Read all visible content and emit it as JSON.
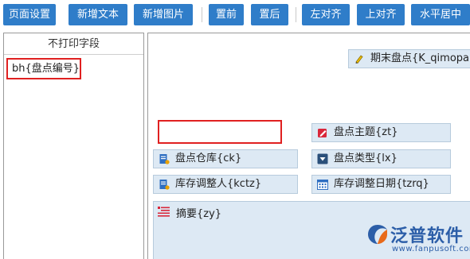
{
  "toolbar": {
    "buttons": [
      {
        "label": "页面设置"
      },
      {
        "label": "新增文本"
      },
      {
        "label": "新增图片"
      },
      {
        "label": "置前"
      },
      {
        "label": "置后"
      },
      {
        "label": "左对齐"
      },
      {
        "label": "上对齐"
      },
      {
        "label": "水平居中"
      }
    ]
  },
  "left_panel": {
    "title": "不打印字段",
    "fields": [
      {
        "label": "bh{盘点编号}"
      }
    ]
  },
  "canvas": {
    "fields": [
      {
        "label": "期末盘点{K_qimopand",
        "icon": "pencil-icon"
      },
      {
        "label": "盘点主题{zt}",
        "icon": "edit-icon"
      },
      {
        "label": "盘点仓库{ck}",
        "icon": "document-icon"
      },
      {
        "label": "盘点类型{lx}",
        "icon": "dropdown-icon"
      },
      {
        "label": "库存调整人{kctz}",
        "icon": "document-icon"
      },
      {
        "label": "库存调整日期{tzrq}",
        "icon": "calendar-icon"
      }
    ],
    "remark": {
      "label": "摘要{zy}",
      "icon": "text-lines-icon"
    }
  },
  "watermark": {
    "brand": "泛普软件",
    "url": "www.fanpusoft.com"
  },
  "colors": {
    "toolbar_button": "#2f7dc9",
    "field_bg": "#dde9f4",
    "highlight": "#e02020",
    "brand": "#2c5ea8"
  }
}
